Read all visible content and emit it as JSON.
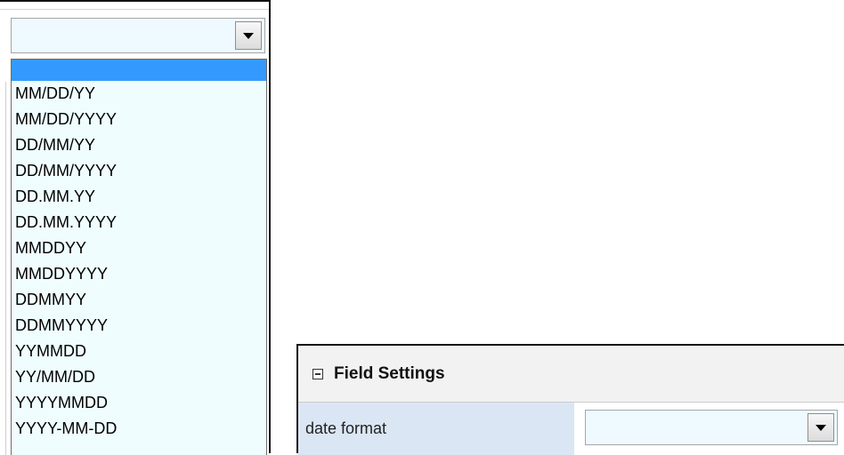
{
  "left_dropdown": {
    "value": "",
    "options": [
      {
        "label": "",
        "selected": true
      },
      {
        "label": "MM/DD/YY"
      },
      {
        "label": "MM/DD/YYYY"
      },
      {
        "label": "DD/MM/YY"
      },
      {
        "label": "DD/MM/YYYY"
      },
      {
        "label": "DD.MM.YY"
      },
      {
        "label": "DD.MM.YYYY"
      },
      {
        "label": "MMDDYY"
      },
      {
        "label": "MMDDYYYY"
      },
      {
        "label": "DDMMYY"
      },
      {
        "label": "DDMMYYYY"
      },
      {
        "label": "YYMMDD"
      },
      {
        "label": "YY/MM/DD"
      },
      {
        "label": "YYYYMMDD"
      },
      {
        "label": "YYYY-MM-DD"
      }
    ]
  },
  "field_settings": {
    "title": "Field Settings",
    "collapse_icon": "minus-box-icon",
    "row": {
      "label": "date format",
      "value": ""
    }
  },
  "colors": {
    "select_bg": "#eefaff",
    "highlight": "#3399ff",
    "label_cell_bg": "#dbe6f4",
    "header_bg": "#f2f2f2"
  }
}
